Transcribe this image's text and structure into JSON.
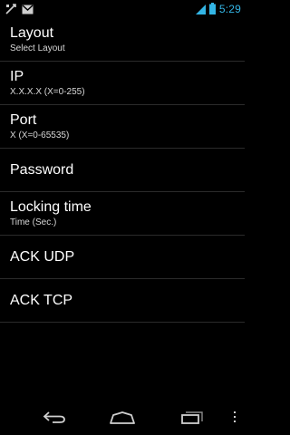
{
  "status_bar": {
    "time": "5:29",
    "accent_color": "#33b5e5",
    "icons_left": [
      "usb-icon",
      "gmail-icon"
    ],
    "icons_right": [
      "signal-icon",
      "battery-icon"
    ]
  },
  "settings": {
    "items": [
      {
        "title": "Layout",
        "summary": "Select Layout"
      },
      {
        "title": "IP",
        "summary": "X.X.X.X (X=0-255)"
      },
      {
        "title": "Port",
        "summary": "X (X=0-65535)"
      },
      {
        "title": "Password"
      },
      {
        "title": "Locking time",
        "summary": "Time (Sec.)"
      },
      {
        "title": "ACK UDP"
      },
      {
        "title": "ACK TCP"
      }
    ]
  },
  "nav_bar": {
    "buttons": [
      "back-icon",
      "home-icon",
      "recent-apps-icon",
      "overflow-menu-icon"
    ]
  }
}
